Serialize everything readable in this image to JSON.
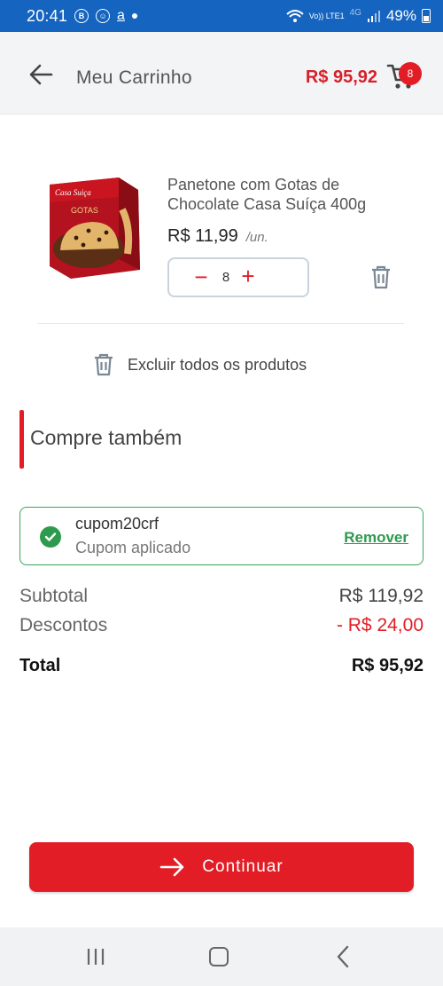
{
  "status_bar": {
    "time": "20:41",
    "net_type": "Vo)) LTE1",
    "net_gen": "4G",
    "battery": "49%"
  },
  "header": {
    "title": "Meu Carrinho",
    "cart_total": "R$ 95,92",
    "cart_count": "8"
  },
  "item": {
    "name": "Panetone com Gotas de Chocolate Casa Suíça 400g",
    "price": "R$ 11,99",
    "unit": "/un.",
    "quantity": "8",
    "image_brand": "Casa Suiça",
    "image_label": "GOTAS"
  },
  "actions": {
    "clear_all": "Excluir todos os produtos",
    "continue": "Continuar"
  },
  "section": {
    "title": "Compre também"
  },
  "coupon": {
    "code": "cupom20crf",
    "status": "Cupom aplicado",
    "remove": "Remover"
  },
  "summary": {
    "subtotal_label": "Subtotal",
    "subtotal": "R$ 119,92",
    "discount_label": "Descontos",
    "discount": "- R$ 24,00",
    "total_label": "Total",
    "total": "R$ 95,92"
  },
  "colors": {
    "brand_red": "#e21d26",
    "status_blue": "#1565c0",
    "success_green": "#2e9a4e"
  }
}
